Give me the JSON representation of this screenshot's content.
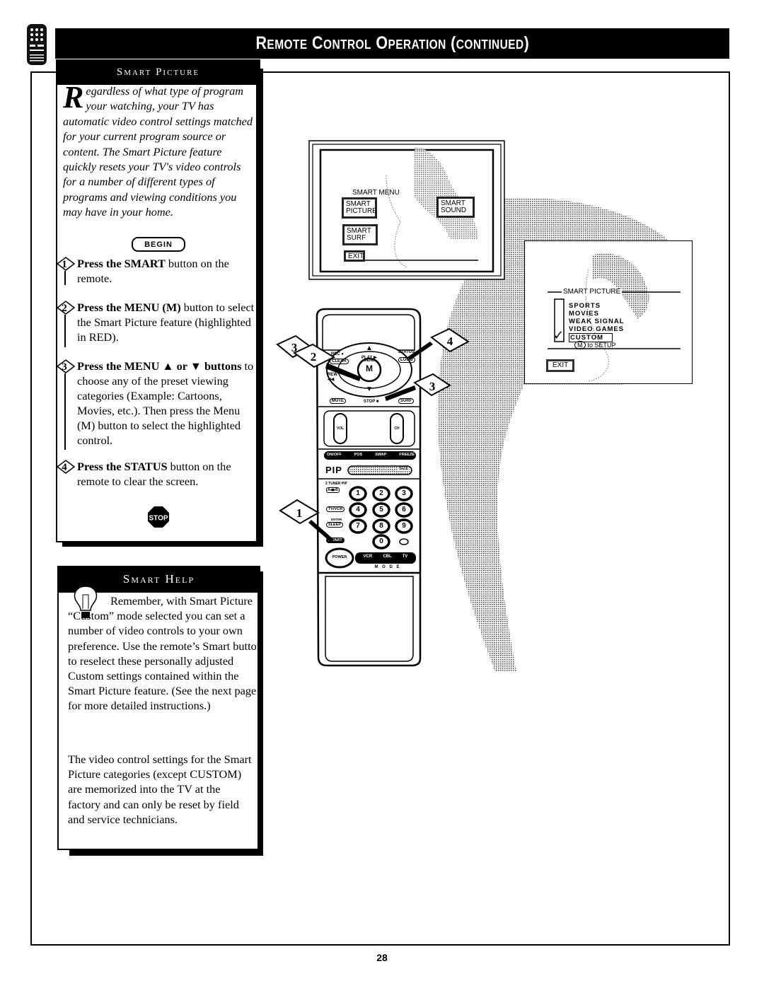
{
  "header": {
    "title": "Remote Control Operation (continued)",
    "logo_icon": "remote-control-icon"
  },
  "smart_picture": {
    "heading": "Smart Picture",
    "intro_dropcap": "R",
    "intro_text": "egardless of what type of program your watching, your TV has automatic video control settings matched for your current program source or content. The Smart Picture feature quickly resets your TV's video controls for a number of different types of programs and viewing conditions you may have in your home.",
    "begin_label": "BEGIN",
    "steps": [
      {
        "num": "1",
        "bold": "Press the SMART",
        "text": " button on the remote."
      },
      {
        "num": "2",
        "bold": "Press the MENU (M)",
        "text": " button to select the Smart Picture feature (highlighted in RED)."
      },
      {
        "num": "3",
        "bold": "Press the MENU ▲ or ▼ buttons",
        "text": " to choose any of the preset viewing categories (Example: Cartoons, Movies, etc.). Then press the Menu (M) button to select the highlighted control."
      },
      {
        "num": "4",
        "bold": "Press the STATUS",
        "text": " button on the remote to clear the screen."
      }
    ],
    "stop_label": "STOP"
  },
  "smart_help": {
    "heading": "Smart Help",
    "paragraph1": "Remember, with Smart Picture “Custom” mode selected you can set a number of video controls to your own preference. Use the remote’s Smart button to reselect these personally adjusted Custom settings contained within the Smart Picture feature. (See the next page for more detailed instructions.)",
    "paragraph2": "The video control settings for the Smart Picture categories (except CUSTOM) are memorized into the TV at the factory and can only be reset by field and service technicians."
  },
  "screen1": {
    "menu_title": "SMART MENU",
    "items": [
      "SMART PICTURE",
      "SMART SOUND",
      "SMART SURF",
      "EXIT"
    ],
    "highlighted": "SMART PICTURE"
  },
  "screen2": {
    "menu_title": "SMART PICTURE",
    "options": [
      "SPORTS",
      "MOVIES",
      "WEAK SIGNAL",
      "VIDEO GAMES",
      "CUSTOM"
    ],
    "selected": "CUSTOM",
    "hint_key": "M",
    "hint_text": "to SETUP",
    "exit_label": "EXIT"
  },
  "remote": {
    "top_labels": [
      "REC ●",
      "PLAY ▶",
      "STATUS"
    ],
    "buttons_top": [
      "CLEAR",
      "LOGO"
    ],
    "menu_key": "M",
    "menu_small": "MENU",
    "rew_label": "REW ◀◀",
    "stop_label": "STOP ■",
    "mute_label": "MUTE",
    "surf_label": "SURF",
    "vol_label": "VOL",
    "ch_label": "CH",
    "pip_row": [
      "ON/OFF",
      "POS",
      "SWAP",
      "FREEZE"
    ],
    "pip_label": "PIP",
    "size_label": "SIZE",
    "tuner_label": "2 TUNER PIP",
    "ab_label": "A◀▶B",
    "tvvcr_label": "TV/VCR",
    "enter_label": "ENTER",
    "sleep_label": "SLEEP",
    "smart_label": "SMART",
    "digits": [
      "1",
      "2",
      "3",
      "4",
      "5",
      "6",
      "7",
      "8",
      "9",
      "0"
    ],
    "power_label": "POWER",
    "mode_buttons": [
      "VCR",
      "CBL",
      "TV"
    ],
    "mode_label": "M O D E",
    "callouts": [
      "1",
      "2",
      "3",
      "3",
      "4"
    ]
  },
  "page_number": "28"
}
